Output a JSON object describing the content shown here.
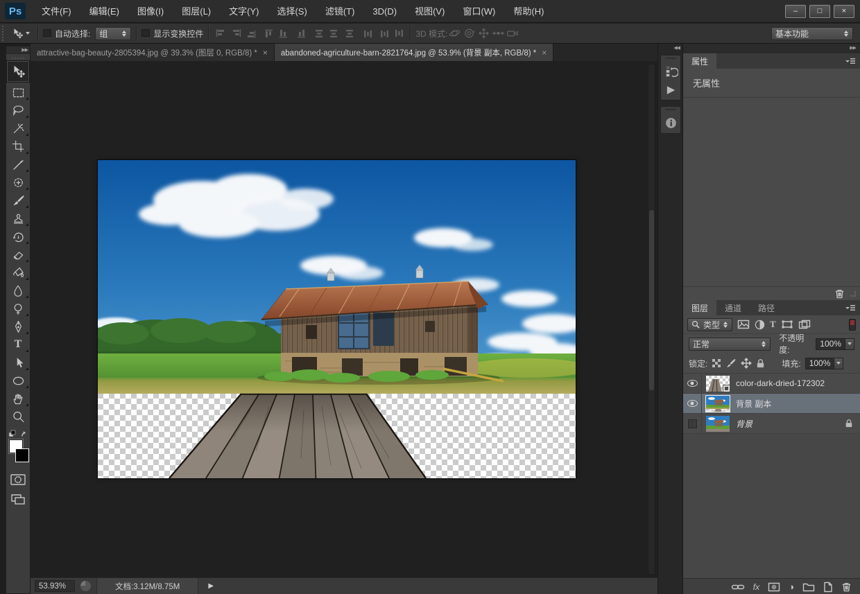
{
  "menu_bar": {
    "logo": "Ps",
    "items": [
      "文件(F)",
      "编辑(E)",
      "图像(I)",
      "图层(L)",
      "文字(Y)",
      "选择(S)",
      "滤镜(T)",
      "3D(D)",
      "视图(V)",
      "窗口(W)",
      "帮助(H)"
    ]
  },
  "window_controls": {
    "minimize": "–",
    "maximize": "□",
    "close": "×"
  },
  "options_bar": {
    "auto_select_label": "自动选择:",
    "auto_select_value": "组",
    "show_transform_label": "显示变换控件",
    "mode_3d_label": "3D 模式:",
    "workspace": "基本功能"
  },
  "tabs": [
    {
      "title": "attractive-bag-beauty-2805394.jpg @ 39.3% (图层 0, RGB/8) *",
      "active": false
    },
    {
      "title": "abandoned-agriculture-barn-2821764.jpg @ 53.9% (背景 副本, RGB/8) *",
      "active": true
    }
  ],
  "toolbar": {
    "tools": [
      "move",
      "rectangular-marquee",
      "lasso",
      "magic-wand",
      "crop",
      "eyedropper",
      "healing-brush",
      "brush",
      "clone-stamp",
      "history-brush",
      "eraser",
      "paint-bucket",
      "blur",
      "dodge",
      "pen",
      "type",
      "path-selection",
      "ellipse",
      "hand",
      "zoom"
    ],
    "foreground_color": "#ffffff",
    "background_color": "#000000"
  },
  "properties_panel": {
    "tab": "属性",
    "empty_text": "无属性"
  },
  "layers_panel": {
    "tabs": [
      "图层",
      "通道",
      "路径"
    ],
    "filter_type": "类型",
    "blend_mode": "正常",
    "opacity_label": "不透明度:",
    "opacity_value": "100%",
    "lock_label": "锁定:",
    "fill_label": "填充:",
    "fill_value": "100%",
    "layers": [
      {
        "name": "color-dark-dried-172302",
        "visible": true,
        "selected": false
      },
      {
        "name": "背景 副本",
        "visible": true,
        "selected": true
      },
      {
        "name": "背景",
        "visible": false,
        "selected": false,
        "locked": true
      }
    ]
  },
  "status_bar": {
    "zoom": "53.93%",
    "doc_info": "文档:3.12M/8.75M"
  },
  "glyphs": {
    "close": "×",
    "collapse_left": "◀◀",
    "collapse_right": "▶▶",
    "play": "▶",
    "arrow_right": "▶",
    "fx": "fx",
    "T": "T",
    "half_circle": "◑"
  },
  "colors": {
    "ui_background": "#3c3c3c",
    "pasteboard": "#202020",
    "selected_layer": "#68707a",
    "logo_blue": "#6cb8f0",
    "sky_blue": "#1a66ad"
  }
}
